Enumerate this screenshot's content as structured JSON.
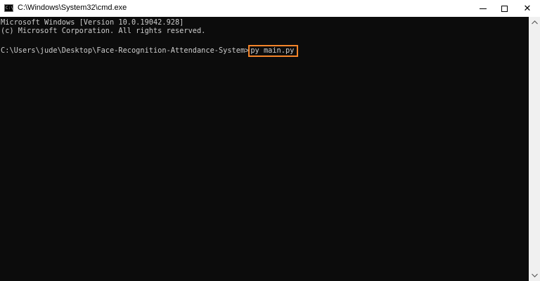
{
  "window": {
    "title": "C:\\Windows\\System32\\cmd.exe",
    "app_icon_text": "C:\\",
    "app_icon": "cmd-icon",
    "controls": {
      "minimize_icon": "minimize-icon",
      "maximize_icon": "maximize-icon",
      "close_icon": "close-icon",
      "close_glyph": "✕"
    }
  },
  "console": {
    "lines": [
      "Microsoft Windows [Version 10.0.19042.928]",
      "(c) Microsoft Corporation. All rights reserved."
    ],
    "prompt": "C:\\Users\\jude\\Desktop\\Face-Recognition-Attendance-System>",
    "command": "py main.py",
    "highlight_color": "#f5852a"
  },
  "scrollbar": {
    "up_icon": "scroll-up-arrow-icon",
    "down_icon": "scroll-down-arrow-icon"
  }
}
